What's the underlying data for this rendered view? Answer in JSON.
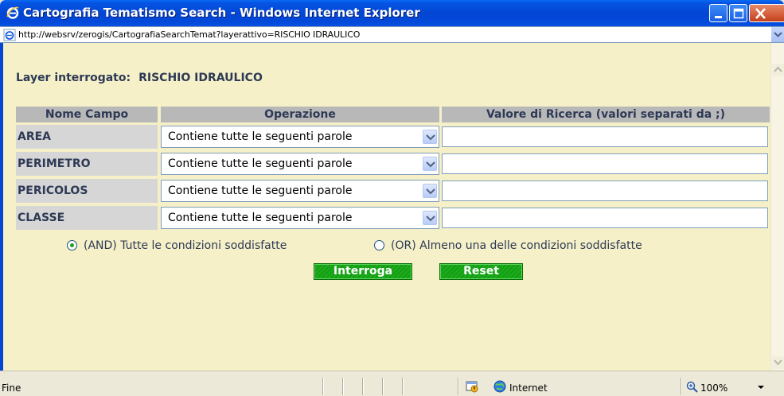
{
  "window": {
    "title": "Cartografia Tematismo Search - Windows Internet Explorer",
    "address": "http://websrv/zerogis/CartografiaSearchTemat?layerattivo=RISCHIO IDRAULICO"
  },
  "page": {
    "layer_label": "Layer interrogato:",
    "layer_value": "RISCHIO IDRAULICO",
    "headers": {
      "nome": "Nome Campo",
      "operazione": "Operazione",
      "valore": "Valore di Ricerca (valori separati da ;)"
    },
    "rows": [
      {
        "name": "AREA",
        "operation": "Contiene tutte le seguenti parole",
        "value": ""
      },
      {
        "name": "PERIMETRO",
        "operation": "Contiene tutte le seguenti parole",
        "value": ""
      },
      {
        "name": "PERICOLOS",
        "operation": "Contiene tutte le seguenti parole",
        "value": ""
      },
      {
        "name": "CLASSE",
        "operation": "Contiene tutte le seguenti parole",
        "value": ""
      }
    ],
    "radio_and": {
      "label": "(AND) Tutte le condizioni soddisfatte",
      "checked": true
    },
    "radio_or": {
      "label": "(OR) Almeno una delle condizioni soddisfatte",
      "checked": false
    },
    "btn_interroga": "Interroga",
    "btn_reset": "Reset"
  },
  "status": {
    "text": "Fine",
    "zone": "Internet",
    "zoom": "100%"
  },
  "colors": {
    "content_bg": "#f5f0c8",
    "header_bg": "#b8b8b8",
    "label_text": "#2e3a55",
    "button_green": "#12a512",
    "titlebar_blue": "#0346d4"
  }
}
